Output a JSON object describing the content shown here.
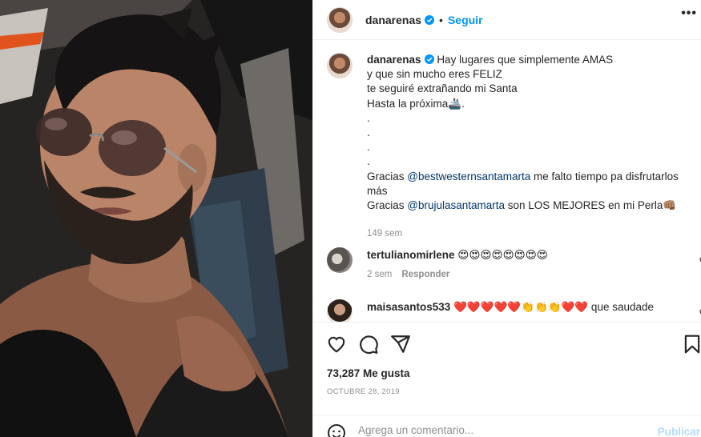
{
  "post": {
    "username": "danarenas",
    "follow_label": "Seguir",
    "dot": "•",
    "more_label": "•••"
  },
  "caption": {
    "username": "danarenas",
    "lines": [
      "Hay lugares que simplemente AMAS",
      "y que sin mucho eres FELIZ",
      "te seguiré extrañando mi Santa",
      "Hasta la próxima🚢.",
      ".",
      ".",
      ".",
      "."
    ],
    "thanks1_prefix": "Gracias ",
    "thanks1_mention": "@bestwesternsantamarta",
    "thanks1_suffix": " me falto tiempo pa disfrutarlos más",
    "thanks2_prefix": "Gracias ",
    "thanks2_mention": "@brujulasantamarta",
    "thanks2_suffix": " son LOS MEJORES en mi Perla👊🏽",
    "time": "149 sem"
  },
  "comments": [
    {
      "username": "tertulianomirlene",
      "text": "😍😍😍😍😍😍😍😍",
      "time": "2 sem",
      "reply": "Responder"
    },
    {
      "username": "maisasantos533",
      "text": "❤️❤️❤️❤️❤️👏👏👏❤️❤️ que saudade"
    }
  ],
  "stats": {
    "likes": "73,287 Me gusta",
    "date": "OCTUBRE 28, 2019"
  },
  "add_comment": {
    "placeholder": "Agrega un comentario...",
    "publish_label": "Publicar"
  },
  "icons": {
    "heart": "heart-icon",
    "comment": "comment-icon",
    "share": "share-icon",
    "save": "bookmark-icon",
    "emoji": "smiley-icon",
    "verified": "verified-badge-icon"
  },
  "colors": {
    "accent": "#0095f6",
    "mention": "#00376b",
    "muted": "#8e8e8e",
    "publish_disabled": "#b3dbff"
  }
}
